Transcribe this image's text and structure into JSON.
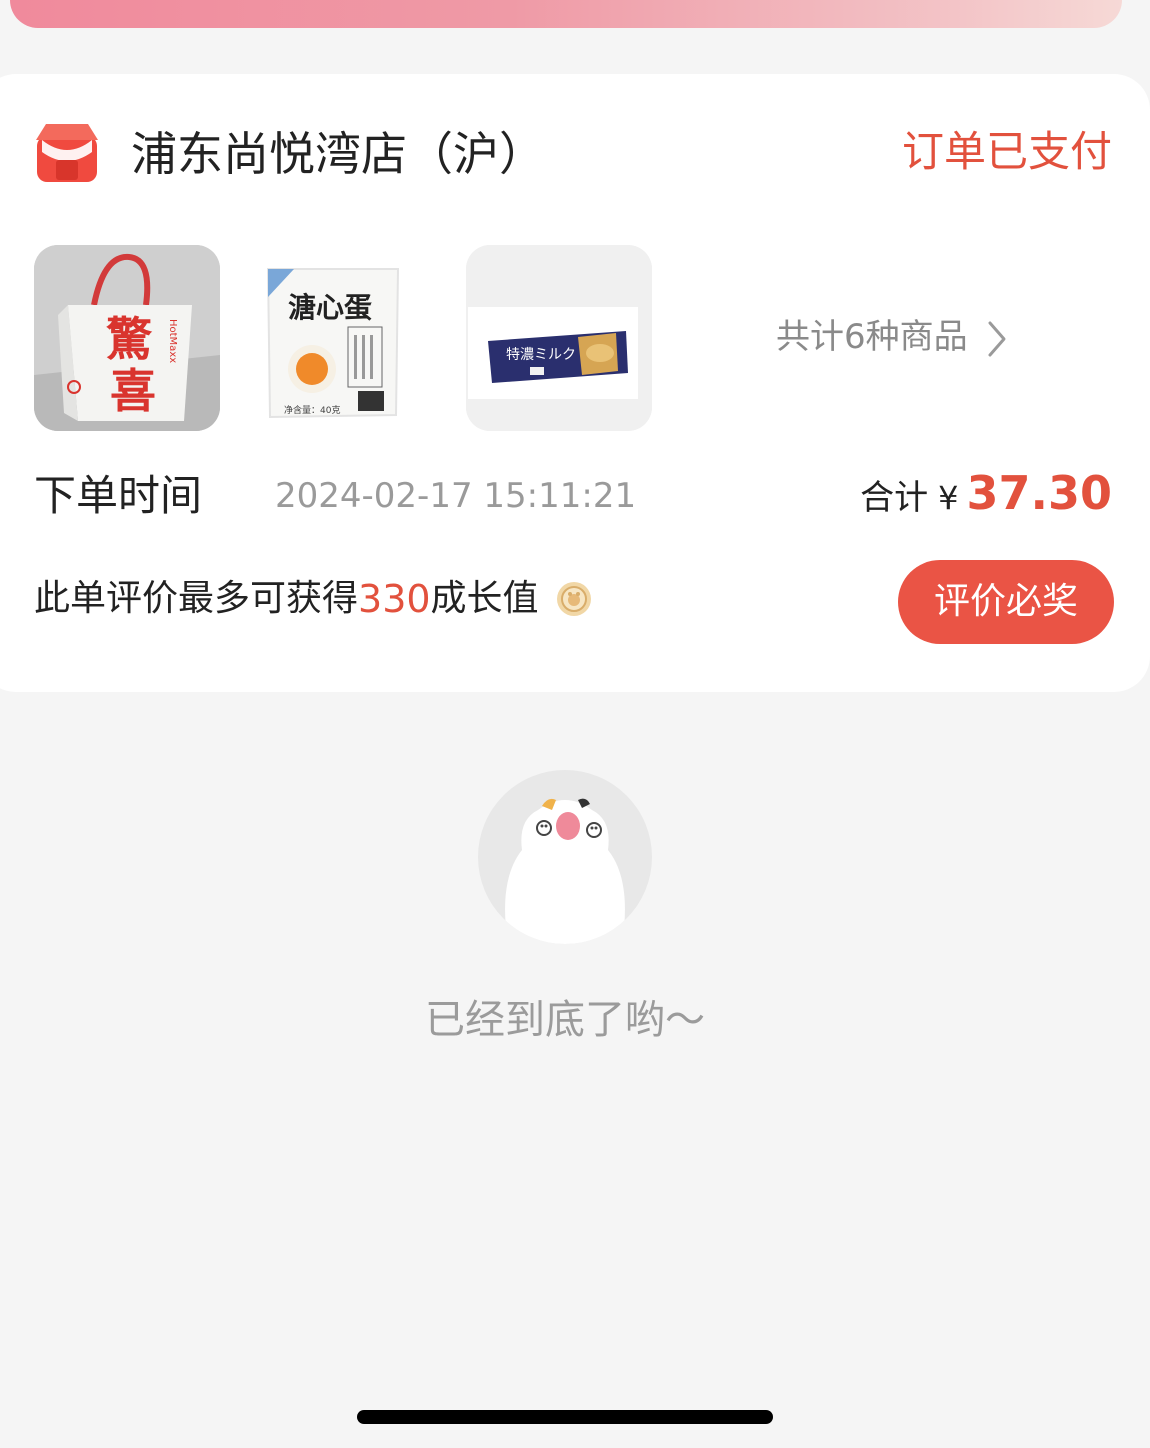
{
  "order": {
    "store_name": "浦东尚悦湾店（沪）",
    "status": "订单已支付",
    "product_count_text": "共计6种商品",
    "time_label": "下单时间",
    "time_value": "2024-02-17 15:11:21",
    "total_label": "合计",
    "currency": "¥",
    "total_amount": "37.30",
    "growth_prefix": "此单评价最多可获得",
    "growth_value": "330",
    "growth_suffix": "成长值",
    "review_button": "评价必奖",
    "products": [
      {
        "name": "惊喜",
        "brand": "HotMaxx"
      },
      {
        "name": "溏心蛋",
        "weight": "净含量：40克"
      },
      {
        "name": "特濃ミルク"
      }
    ]
  },
  "footer": {
    "end_text": "已经到底了哟～"
  },
  "icons": {
    "store": "store-icon",
    "chevron": "chevron-right-icon",
    "coin": "growth-coin-icon",
    "empty": "bear-illustration"
  },
  "colors": {
    "accent": "#e2513d",
    "button": "#ea5445",
    "background": "#f5f5f5",
    "muted": "#9b9b9b"
  }
}
